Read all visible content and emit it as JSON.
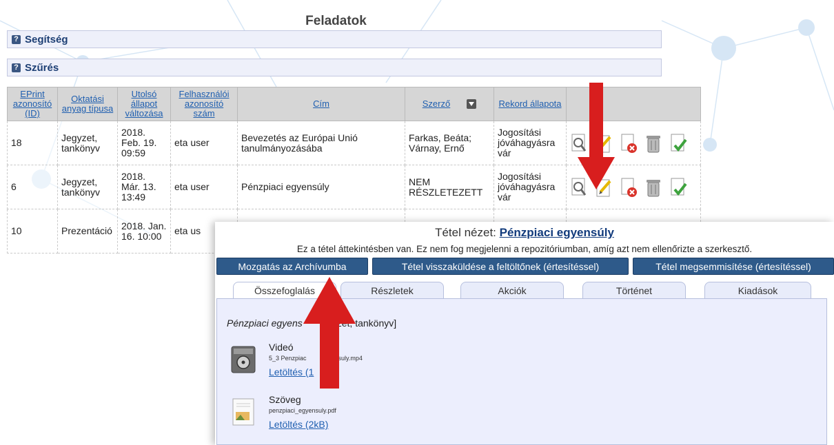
{
  "page": {
    "title": "Feladatok",
    "help_label": "Segítség",
    "filter_label": "Szűrés"
  },
  "table": {
    "headers": {
      "id": "EPrint azonosító (ID)",
      "type": "Oktatási anyag típusa",
      "changed": "Utolsó állapot változása",
      "user": "Felhasználói azonosító szám",
      "title": "Cím",
      "author": "Szerző",
      "status": "Rekord állapota"
    },
    "rows": [
      {
        "id": "18",
        "type": "Jegyzet, tankönyv",
        "date": "2018. Feb. 19. 09:59",
        "user": "eta user",
        "title": "Bevezetés az Európai Unió tanulmányozásába",
        "author": "Farkas, Beáta; Várnay, Ernő",
        "status": "Jogosítási jóváhagyásra vár"
      },
      {
        "id": "6",
        "type": "Jegyzet, tankönyv",
        "date": "2018. Már. 13. 13:49",
        "user": "eta user",
        "title": "Pénzpiaci egyensúly",
        "author": "NEM RÉSZLETEZETT",
        "status": "Jogosítási jóváhagyásra vár"
      },
      {
        "id": "10",
        "type": "Prezentáció",
        "date": "2018. Jan. 16. 10:00",
        "user": "eta us",
        "title": "",
        "author": "",
        "status": ""
      }
    ]
  },
  "detail": {
    "title_prefix": "Tétel nézet: ",
    "title_link": "Pénzpiaci egyensúly",
    "note": "Ez a tétel áttekintésben van. Ez nem fog megjelenni a repozitóriumban, amíg azt nem ellenőrizte a szerkesztő.",
    "buttons": {
      "archive": "Mozgatás az Archívumba",
      "return": "Tétel visszaküldése a feltöltőnek (értesítéssel)",
      "destroy": "Tétel megsemmisítése (értesítéssel)"
    },
    "tabs": [
      "Összefoglalás",
      "Részletek",
      "Akciók",
      "Történet",
      "Kiadások"
    ],
    "summary_left": "Pénzpiaci egyens",
    "summary_right": "zet, tankönyv]",
    "files": [
      {
        "type": "Videó",
        "name": "5_3 Penzpiac",
        "name_tail": "suly.mp4",
        "download": "Letöltés (1"
      },
      {
        "type": "Szöveg",
        "name": "penzpiaci_egyensuly.pdf",
        "name_tail": "",
        "download": "Letöltés (2kB)"
      }
    ]
  },
  "colors": {
    "arrow": "#d81e1e",
    "button": "#2e5a8a",
    "link": "#1f5fb0"
  }
}
